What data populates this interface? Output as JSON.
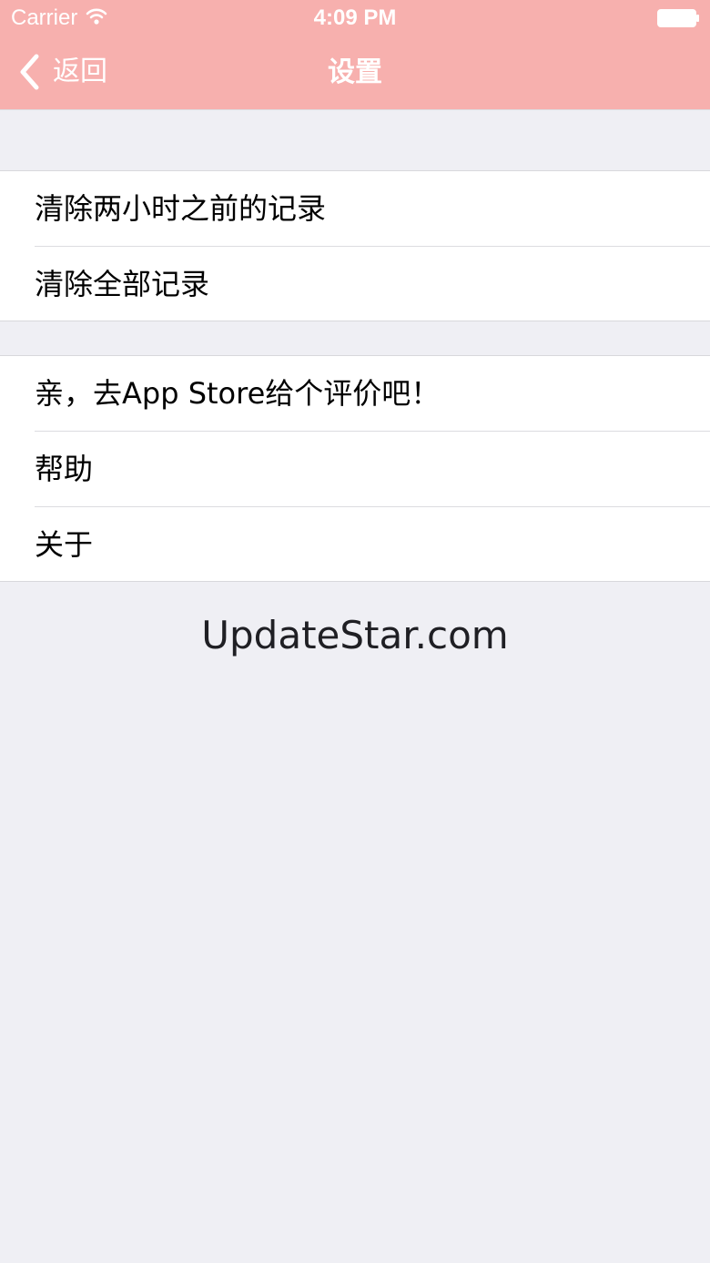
{
  "status_bar": {
    "carrier": "Carrier",
    "time": "4:09 PM",
    "wifi_icon": "wifi-icon",
    "battery_icon": "battery-icon"
  },
  "nav": {
    "back_label": "返回",
    "back_icon": "chevron-left-icon",
    "title": "设置",
    "bar_color": "#f7b0ae"
  },
  "groups": [
    {
      "items": [
        {
          "label": "清除两小时之前的记录"
        },
        {
          "label": "清除全部记录"
        }
      ]
    },
    {
      "items": [
        {
          "label": "亲，去App Store给个评价吧！"
        },
        {
          "label": "帮助"
        },
        {
          "label": "关于"
        }
      ]
    }
  ],
  "footer": {
    "text": "UpdateStar.com"
  }
}
